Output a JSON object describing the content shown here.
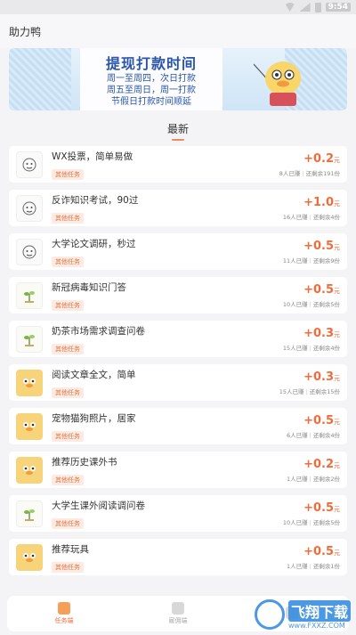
{
  "status": {
    "time": "9:54"
  },
  "header": {
    "title": "助力鸭"
  },
  "banner": {
    "title": "提现打款时间",
    "lines": [
      "周一至周四，次日打款",
      "周五至周日，周一打款",
      "节假日打款时间顺延"
    ]
  },
  "section": {
    "title": "最新"
  },
  "tasks": [
    {
      "title": "WX投票，简单易做",
      "tag": "其他任务",
      "reward": "+0.2",
      "unit": "元",
      "done": "8人已赚",
      "left": "还剩余191份",
      "avatar": "doodle"
    },
    {
      "title": "反诈知识考试，90过",
      "tag": "其他任务",
      "reward": "+1.0",
      "unit": "元",
      "done": "16人已赚",
      "left": "还剩余4份",
      "avatar": "doodle"
    },
    {
      "title": "大学论文调研，秒过",
      "tag": "其他任务",
      "reward": "+0.5",
      "unit": "元",
      "done": "11人已赚",
      "left": "还剩余9份",
      "avatar": "doodle"
    },
    {
      "title": "新冠病毒知识门答",
      "tag": "其他任务",
      "reward": "+0.5",
      "unit": "元",
      "done": "10人已赚",
      "left": "还剩余5份",
      "avatar": "plant"
    },
    {
      "title": "奶茶市场需求调查问卷",
      "tag": "其他任务",
      "reward": "+0.3",
      "unit": "元",
      "done": "15人已赚",
      "left": "还剩余4份",
      "avatar": "plant"
    },
    {
      "title": "阅读文章全文，简单",
      "tag": "其他任务",
      "reward": "+0.3",
      "unit": "元",
      "done": "15人已赚",
      "left": "还剩余15份",
      "avatar": "duck"
    },
    {
      "title": "宠物猫狗照片，居家",
      "tag": "其他任务",
      "reward": "+0.5",
      "unit": "元",
      "done": "6人已赚",
      "left": "还剩余4份",
      "avatar": "duck"
    },
    {
      "title": "推荐历史课外书",
      "tag": "其他任务",
      "reward": "+0.2",
      "unit": "元",
      "done": "1人已赚",
      "left": "还剩余2份",
      "avatar": "duck"
    },
    {
      "title": "大学生课外阅读调问卷",
      "tag": "其他任务",
      "reward": "+0.5",
      "unit": "元",
      "done": "10人已赚",
      "left": "还剩余5份",
      "avatar": "plant"
    },
    {
      "title": "推荐玩具",
      "tag": "其他任务",
      "reward": "+0.5",
      "unit": "元",
      "done": "1人已赚",
      "left": "还剩余1份",
      "avatar": "duck"
    }
  ],
  "nav": [
    {
      "label": "任务端",
      "active": true
    },
    {
      "label": "雇佣端",
      "active": false
    },
    {
      "label": "",
      "active": false
    }
  ],
  "watermark": {
    "main": "飞翔下载",
    "sub": "www.FXXZ.COM"
  },
  "colors": {
    "accent": "#f26b3a",
    "tag_bg": "#fdebe3",
    "banner_text": "#2a56a8"
  }
}
